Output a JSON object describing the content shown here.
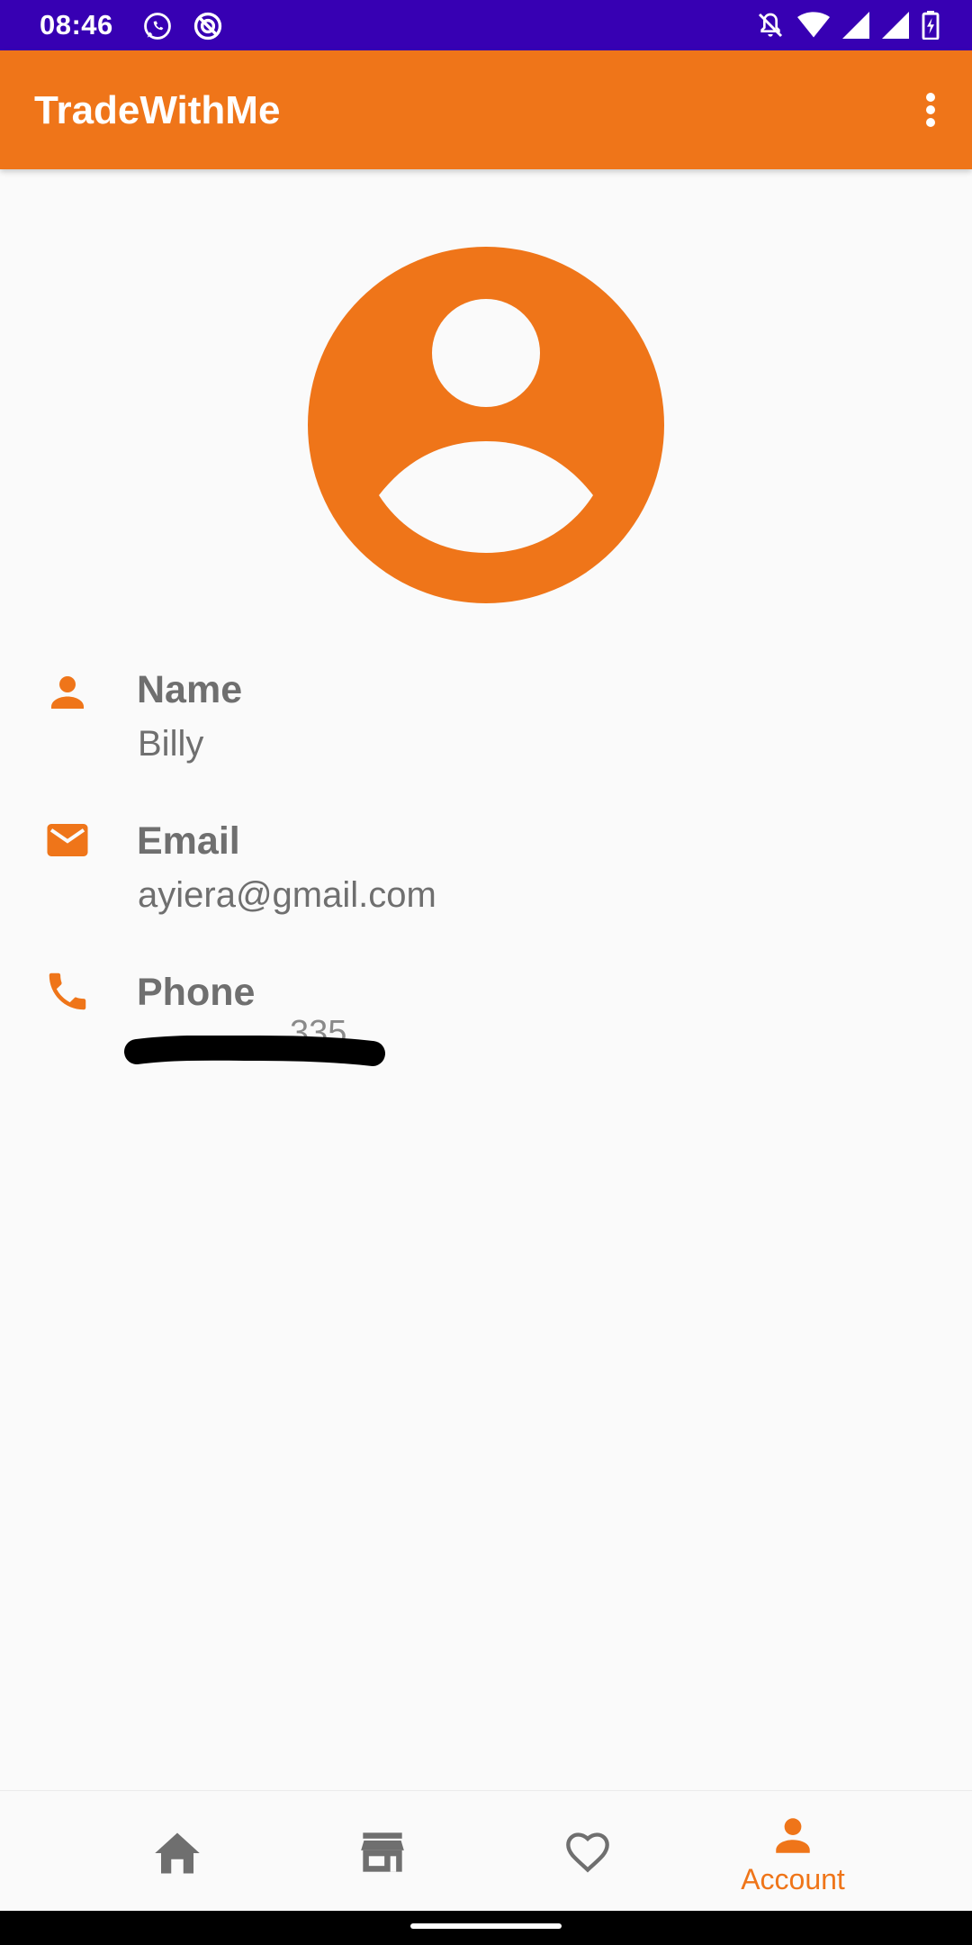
{
  "status_bar": {
    "time": "08:46",
    "icons": [
      "whatsapp-icon",
      "sync-icon",
      "notifications-off-icon",
      "wifi-icon",
      "signal-icon",
      "signal-icon",
      "battery-charging-icon"
    ]
  },
  "app_bar": {
    "title": "TradeWithMe",
    "menu_icon": "more-vert-icon"
  },
  "profile": {
    "avatar_icon": "account-circle-icon",
    "fields": [
      {
        "icon": "person-icon",
        "label": "Name",
        "value": "Billy"
      },
      {
        "icon": "email-icon",
        "label": "Email",
        "value": "ayiera@gmail.com"
      },
      {
        "icon": "phone-icon",
        "label": "Phone",
        "value": "335"
      }
    ]
  },
  "bottom_nav": {
    "items": [
      {
        "icon": "home-icon",
        "label": "",
        "active": false
      },
      {
        "icon": "store-icon",
        "label": "",
        "active": false
      },
      {
        "icon": "heart-outline-icon",
        "label": "",
        "active": false
      },
      {
        "icon": "person-icon",
        "label": "Account",
        "active": true
      }
    ]
  },
  "colors": {
    "primary": "#EF7519",
    "status_bar": "#3700B3",
    "text_secondary": "#6F6F6F",
    "nav_inactive": "#6F6F6F",
    "background": "#FAFAFA"
  }
}
